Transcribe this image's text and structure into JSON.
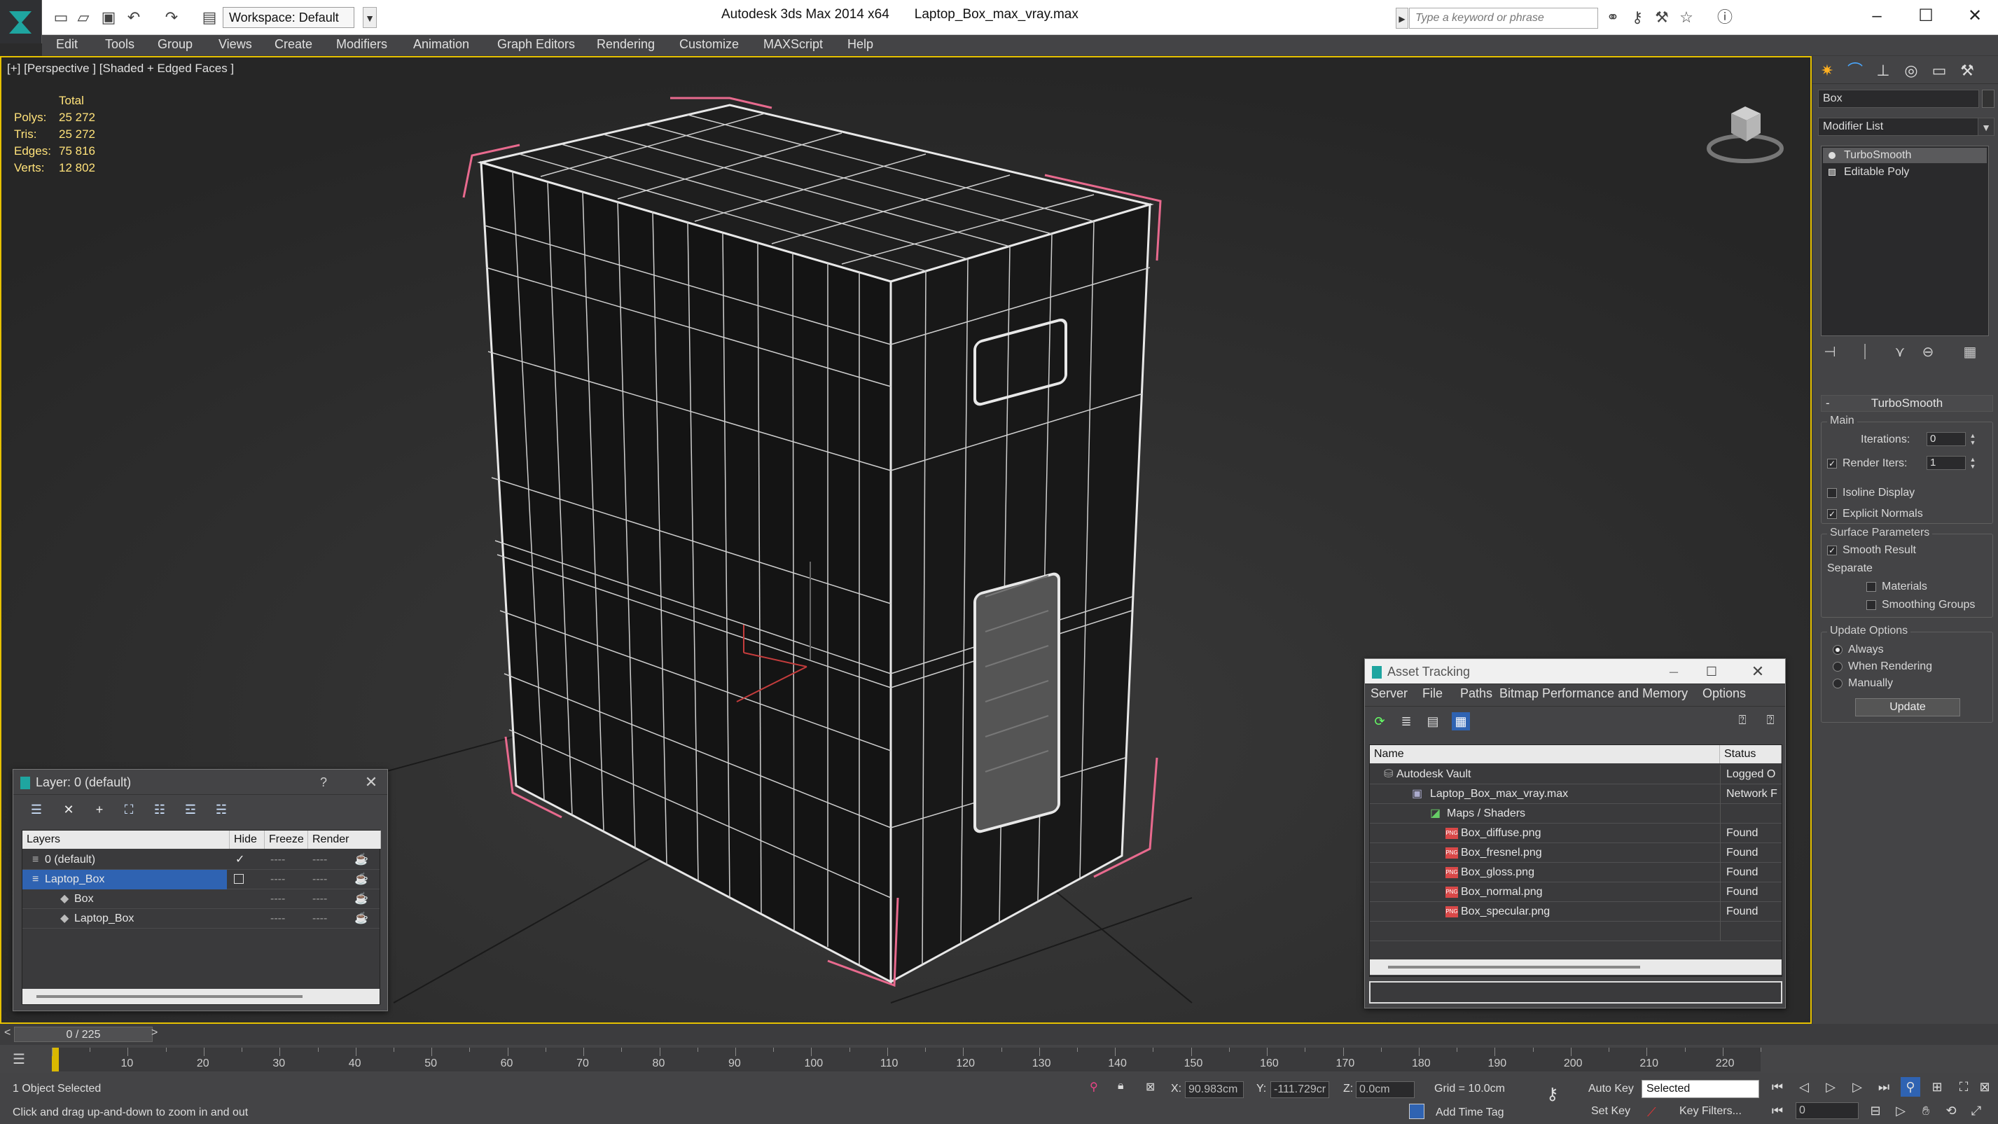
{
  "app": {
    "title": "Autodesk 3ds Max  2014 x64",
    "file_name": "Laptop_Box_max_vray.max",
    "workspace": "Workspace: Default",
    "search_placeholder": "Type a keyword or phrase"
  },
  "menu": [
    "Edit",
    "Tools",
    "Group",
    "Views",
    "Create",
    "Modifiers",
    "Animation",
    "Graph Editors",
    "Rendering",
    "Customize",
    "MAXScript",
    "Help"
  ],
  "viewport": {
    "label": "[+] [Perspective ] [Shaded + Edged Faces ]",
    "stats_header": "Total",
    "stats": [
      {
        "key": "Polys:",
        "value": "25 272"
      },
      {
        "key": "Tris:",
        "value": "25 272"
      },
      {
        "key": "Edges:",
        "value": "75 816"
      },
      {
        "key": "Verts:",
        "value": "12 802"
      }
    ],
    "accent_color": "#e6c100"
  },
  "command_panel": {
    "object_name": "Box",
    "modifier_list": "Modifier List",
    "stack": [
      "TurboSmooth",
      "Editable Poly"
    ],
    "rollout_title": "TurboSmooth",
    "main_label": "Main",
    "iterations_label": "Iterations:",
    "iterations_value": "0",
    "render_iters_label": "Render Iters:",
    "render_iters_value": "1",
    "isoline_display": "Isoline Display",
    "explicit_normals": "Explicit Normals",
    "surface_params_label": "Surface Parameters",
    "smooth_result": "Smooth Result",
    "separate_label": "Separate",
    "materials": "Materials",
    "smoothing_groups": "Smoothing Groups",
    "update_options_label": "Update Options",
    "always": "Always",
    "when_rendering": "When Rendering",
    "manually": "Manually",
    "update_button": "Update"
  },
  "layer_panel": {
    "title": "Layer: 0 (default)",
    "help": "?",
    "columns": [
      "Layers",
      "Hide",
      "Freeze",
      "Render"
    ],
    "rows": [
      {
        "name": "0 (default)"
      },
      {
        "name": "Laptop_Box"
      },
      {
        "name": "Box"
      },
      {
        "name": "Laptop_Box"
      }
    ],
    "dash": "----"
  },
  "asset_panel": {
    "title": "Asset Tracking",
    "menu": [
      "Server",
      "File",
      "Paths",
      "Bitmap Performance and Memory",
      "Options"
    ],
    "columns": [
      "Name",
      "Status"
    ],
    "rows": [
      {
        "name": "Autodesk Vault",
        "status": "Logged O"
      },
      {
        "name": "Laptop_Box_max_vray.max",
        "status": "Network F"
      },
      {
        "name": "Maps / Shaders",
        "status": ""
      },
      {
        "name": "Box_diffuse.png",
        "status": "Found"
      },
      {
        "name": "Box_fresnel.png",
        "status": "Found"
      },
      {
        "name": "Box_gloss.png",
        "status": "Found"
      },
      {
        "name": "Box_normal.png",
        "status": "Found"
      },
      {
        "name": "Box_specular.png",
        "status": "Found"
      }
    ],
    "png_tag": "PNG"
  },
  "timeline": {
    "frame_display": "0 / 225",
    "ticks": [
      "10",
      "20",
      "30",
      "40",
      "50",
      "60",
      "70",
      "80",
      "90",
      "100",
      "110",
      "120",
      "130",
      "140",
      "150",
      "160",
      "170",
      "180",
      "190",
      "200",
      "210",
      "220"
    ],
    "tick_max": 225,
    "current_frame": 0
  },
  "status": {
    "selection": "1 Object Selected",
    "prompt": "Click and drag up-and-down to zoom in and out",
    "x_label": "X:",
    "x_value": "90.983cm",
    "y_label": "Y:",
    "y_value": "-111.729cr",
    "z_label": "Z:",
    "z_value": "0.0cm",
    "grid": "Grid = 10.0cm",
    "add_time_tag": "Add Time Tag",
    "auto_key": "Auto Key",
    "set_key": "Set Key",
    "selected": "Selected",
    "key_filters": "Key Filters...",
    "frame_field": "0"
  }
}
